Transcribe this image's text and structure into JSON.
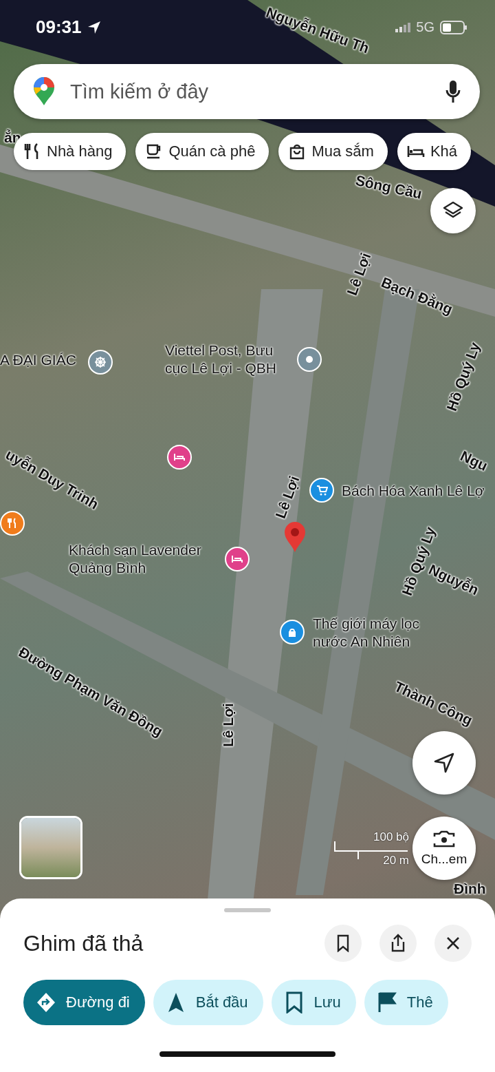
{
  "status_bar": {
    "time": "09:31",
    "network": "5G"
  },
  "search": {
    "placeholder": "Tìm kiếm ở đây"
  },
  "chips": [
    {
      "label": "Nhà hàng",
      "kind": "restaurant"
    },
    {
      "label": "Quán cà phê",
      "kind": "cafe"
    },
    {
      "label": "Mua sắm",
      "kind": "shopping"
    },
    {
      "label": "Khá",
      "kind": "hotel"
    }
  ],
  "map_labels": [
    "Nguyễn Hữu Th",
    "ẳn",
    "Sông Cầu",
    "Bạch Đằng",
    "Lê Lợi",
    "Hồ Quý Ly",
    "uyễn Duy Trinh",
    "Ngu",
    "Lê Lợi",
    "Hồ Quý Ly",
    "Nguyễn",
    "Đường Phạm Văn Đồng",
    "Thành Công",
    "Lê Lợi",
    "Đình"
  ],
  "pois": [
    {
      "label": "A ĐẠI GIÁC",
      "color": "#78909c",
      "kind": "temple"
    },
    {
      "label": "Viettel Post, Bưu\ncục Lê Lợi - QBH",
      "color": "#78909c",
      "kind": "place"
    },
    {
      "color": "#e0408a",
      "kind": "hotel"
    },
    {
      "color": "#f07c1c",
      "kind": "restaurant"
    },
    {
      "label": "Bách Hóa Xanh Lê Lợ",
      "color": "#1a8fe0",
      "kind": "shopping"
    },
    {
      "label": "Khách sạn Lavender\nQuảng Bình",
      "color": "#e0408a",
      "kind": "hotel"
    },
    {
      "label": "Thế giới máy lọc\nnước An Nhiên",
      "color": "#1a8fe0",
      "kind": "store"
    }
  ],
  "scale": {
    "imperial": "100 bộ",
    "metric": "20 m"
  },
  "lens_button": {
    "label": "Ch...em"
  },
  "sheet": {
    "title": "Ghim đã thả",
    "actions": [
      {
        "label": "Đường đi",
        "kind": "directions",
        "selected": true
      },
      {
        "label": "Bắt đầu",
        "kind": "start",
        "selected": false
      },
      {
        "label": "Lưu",
        "kind": "save",
        "selected": false
      },
      {
        "label": "Thê",
        "kind": "label",
        "selected": false
      }
    ]
  }
}
